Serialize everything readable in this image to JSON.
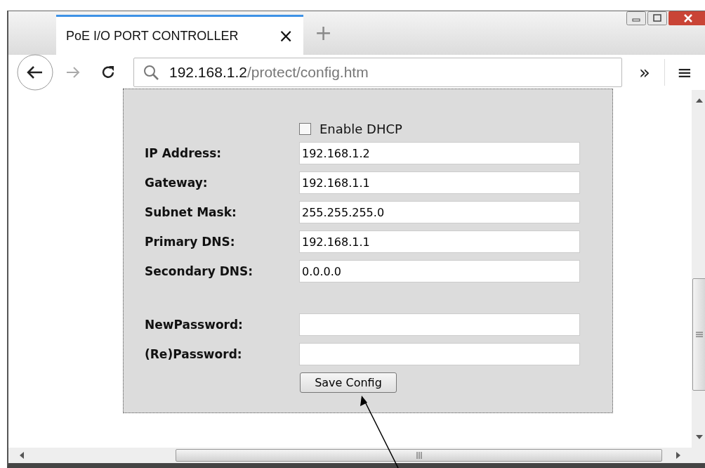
{
  "tab": {
    "title": "PoE I/O PORT CONTROLLER",
    "close": "×",
    "selected": true
  },
  "new_tab": "+",
  "toolbar": {
    "url_host": "192.168.1.2",
    "url_path": "/protect/config.htm",
    "overflow": "»",
    "menu": "≡"
  },
  "form": {
    "dhcp": {
      "label": "Enable DHCP",
      "checked": false
    },
    "fields": [
      {
        "label": "IP Address:",
        "value": "192.168.1.2"
      },
      {
        "label": "Gateway:",
        "value": "192.168.1.1"
      },
      {
        "label": "Subnet Mask:",
        "value": "255.255.255.0"
      },
      {
        "label": "Primary DNS:",
        "value": "192.168.1.1"
      },
      {
        "label": "Secondary DNS:",
        "value": "0.0.0.0"
      }
    ],
    "password_fields": [
      {
        "label": "NewPassword:"
      },
      {
        "label": "(Re)Password:"
      }
    ],
    "button": "Save Config"
  }
}
